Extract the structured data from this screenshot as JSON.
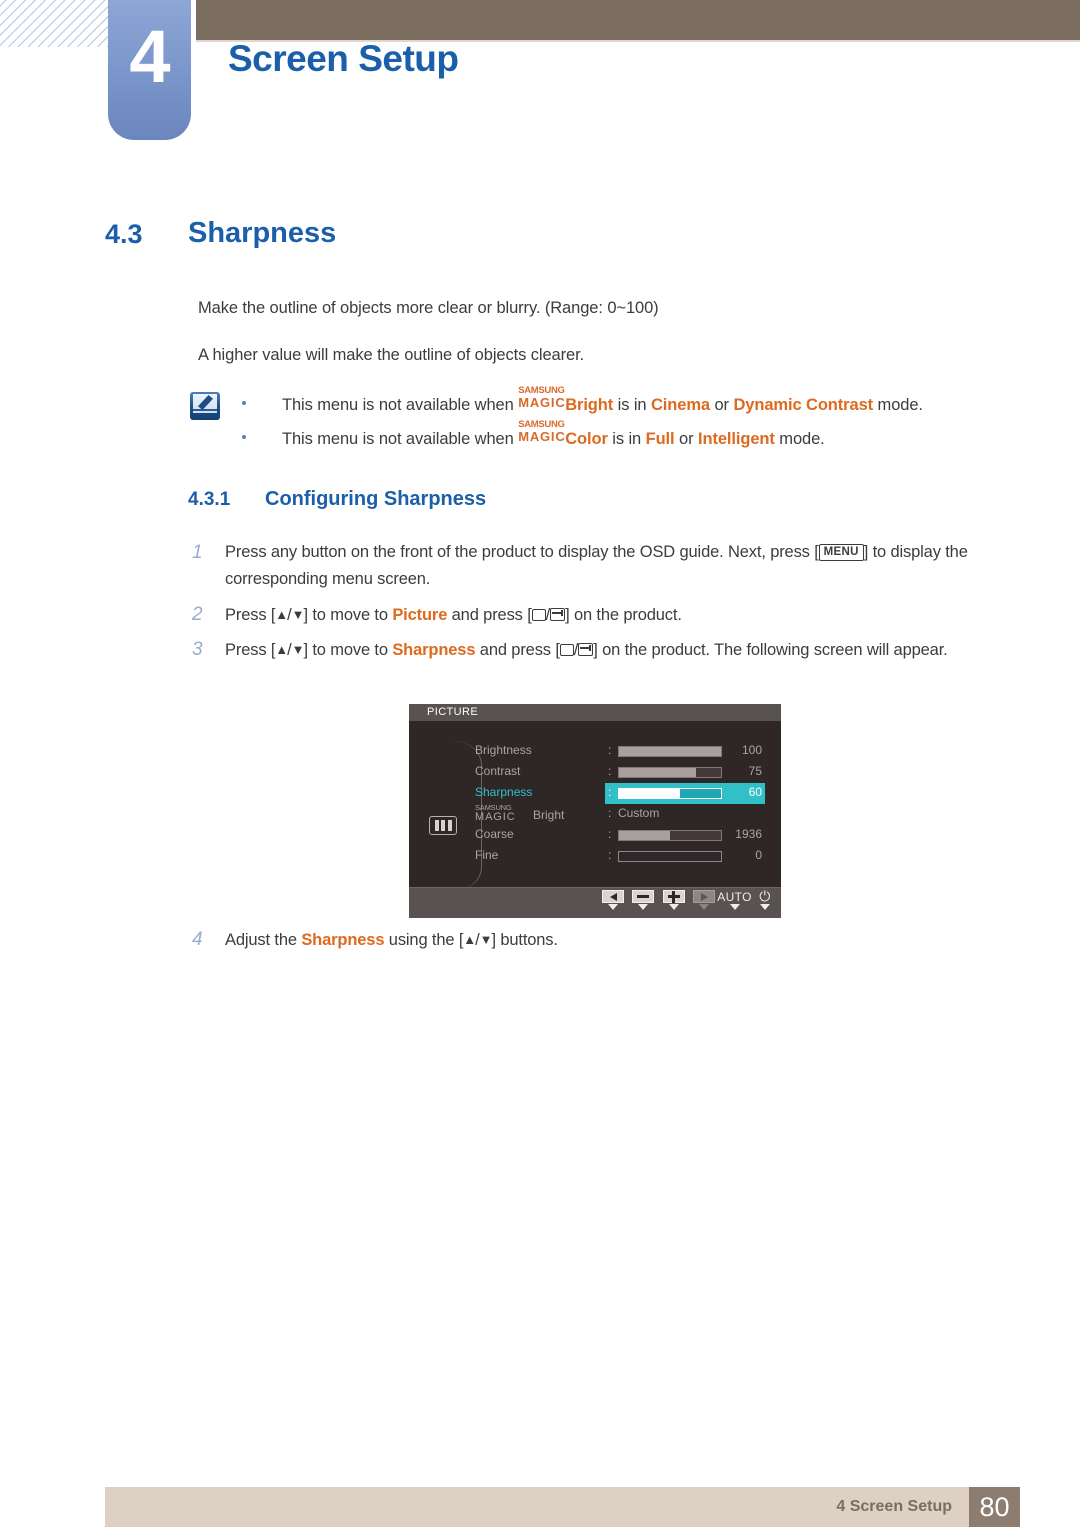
{
  "header": {
    "chapter_number": "4",
    "chapter_title": "Screen Setup"
  },
  "section": {
    "number": "4.3",
    "title": "Sharpness",
    "paragraphs": [
      "Make the outline of objects more clear or blurry. (Range: 0~100)",
      "A higher value will make the outline of objects clearer."
    ],
    "notes": {
      "icon": "note-pencil-icon",
      "items": [
        {
          "prefix": "This menu is not available when ",
          "logo_top": "SAMSUNG",
          "logo_bottom": "MAGIC",
          "logo_suffix": "Bright",
          "mid": " is in ",
          "value1": "Cinema",
          "conj": " or ",
          "value2": "Dynamic Contrast",
          "tail": " mode."
        },
        {
          "prefix": "This menu is not available when ",
          "logo_top": "SAMSUNG",
          "logo_bottom": "MAGIC",
          "logo_suffix": "Color",
          "mid": " is in ",
          "value1": "Full",
          "conj": " or ",
          "value2": "Intelligent",
          "tail": " mode."
        }
      ]
    }
  },
  "subsection": {
    "number": "4.3.1",
    "title": "Configuring Sharpness"
  },
  "steps": [
    {
      "num": "1",
      "part1": "Press any button on the front of the product to display the OSD guide. Next, press [",
      "key": "MENU",
      "part2": "] to display the corresponding menu screen."
    },
    {
      "num": "2",
      "part1": "Press [",
      "glyph_up": "▲",
      "sep": "/",
      "glyph_down": "▼",
      "part2": "] to move to ",
      "highlight": "Picture",
      "part3": " and press [",
      "part4": "] on the product."
    },
    {
      "num": "3",
      "part1": "Press [",
      "glyph_up": "▲",
      "sep": "/",
      "glyph_down": "▼",
      "part2": "] to move to ",
      "highlight": "Sharpness",
      "part3": " and press [",
      "part4": "] on the product. The following screen will appear."
    },
    {
      "num": "4",
      "part1": "Adjust the ",
      "highlight": "Sharpness",
      "part2": " using the [",
      "glyph_up": "▲",
      "sep": "/",
      "glyph_down": "▼",
      "part3": "] buttons."
    }
  ],
  "osd": {
    "title": "PICTURE",
    "category_icon": "picture-bars-icon",
    "rows": [
      {
        "label": "Brightness",
        "colon": ":",
        "value": "100",
        "fill_pct": 100,
        "type": "slider",
        "selected": false
      },
      {
        "label": "Contrast",
        "colon": ":",
        "value": "75",
        "fill_pct": 75,
        "type": "slider",
        "selected": false
      },
      {
        "label": "Sharpness",
        "colon": ":",
        "value": "60",
        "fill_pct": 60,
        "type": "slider",
        "selected": true
      },
      {
        "label_top": "SAMSUNG",
        "label_bottom": "MAGIC",
        "label_suffix": "Bright",
        "colon": ":",
        "value": "Custom",
        "type": "text",
        "selected": false
      },
      {
        "label": "Coarse",
        "colon": ":",
        "value": "1936",
        "fill_pct": 50,
        "type": "slider",
        "selected": false
      },
      {
        "label": "Fine",
        "colon": ":",
        "value": "0",
        "fill_pct": 0,
        "type": "slider",
        "selected": false
      }
    ],
    "buttons": [
      {
        "name": "back-button",
        "glyph": "left-triangle",
        "label": ""
      },
      {
        "name": "minus-button",
        "glyph": "minus",
        "label": ""
      },
      {
        "name": "plus-button",
        "glyph": "plus",
        "label": ""
      },
      {
        "name": "forward-button",
        "glyph": "right-triangle",
        "label": "",
        "dim": true
      },
      {
        "name": "auto-button",
        "glyph": "text",
        "label": "AUTO"
      },
      {
        "name": "power-button",
        "glyph": "power",
        "label": ""
      }
    ],
    "accent_color": "#32c0c8"
  },
  "footer": {
    "text": "4 Screen Setup",
    "page": "80"
  }
}
